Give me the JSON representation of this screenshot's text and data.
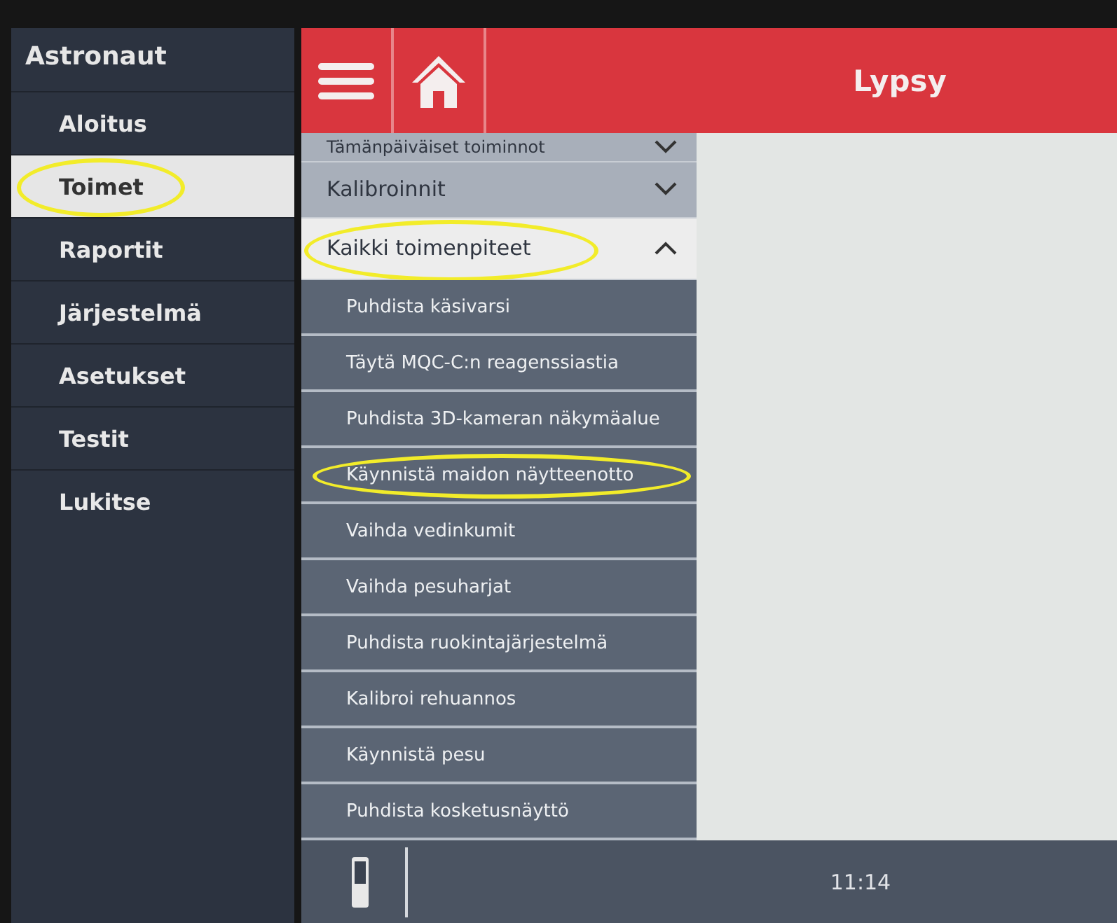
{
  "sidebar": {
    "title": "Astronaut",
    "items": [
      {
        "label": "Aloitus",
        "selected": false,
        "circled": false
      },
      {
        "label": "Toimet",
        "selected": true,
        "circled": true
      },
      {
        "label": "Raportit",
        "selected": false,
        "circled": false
      },
      {
        "label": "Järjestelmä",
        "selected": false,
        "circled": false
      },
      {
        "label": "Asetukset",
        "selected": false,
        "circled": false
      },
      {
        "label": "Testit",
        "selected": false,
        "circled": false
      },
      {
        "label": "Lukitse",
        "selected": false,
        "circled": false
      }
    ]
  },
  "header": {
    "title": "Lypsy"
  },
  "menu": {
    "groups": [
      {
        "label": "Tämänpäiväiset toiminnot",
        "expanded": false,
        "circled": false,
        "partial": true
      },
      {
        "label": "Kalibroinnit",
        "expanded": false,
        "circled": false,
        "partial": false
      },
      {
        "label": "Kaikki toimenpiteet",
        "expanded": true,
        "circled": true,
        "partial": false,
        "children": [
          {
            "label": "Puhdista käsivarsi",
            "circled": false
          },
          {
            "label": "Täytä MQC-C:n reagenssiastia",
            "circled": false
          },
          {
            "label": "Puhdista 3D-kameran näkymäalue",
            "circled": false
          },
          {
            "label": "Käynnistä maidon näytteenotto",
            "circled": true
          },
          {
            "label": "Vaihda vedinkumit",
            "circled": false
          },
          {
            "label": "Vaihda pesuharjat",
            "circled": false
          },
          {
            "label": "Puhdista ruokintajärjestelmä",
            "circled": false
          },
          {
            "label": "Kalibroi rehuannos",
            "circled": false
          },
          {
            "label": "Käynnistä pesu",
            "circled": false
          },
          {
            "label": "Puhdista kosketusnäyttö",
            "circled": false
          }
        ]
      }
    ]
  },
  "status_bar": {
    "time": "11:14"
  }
}
